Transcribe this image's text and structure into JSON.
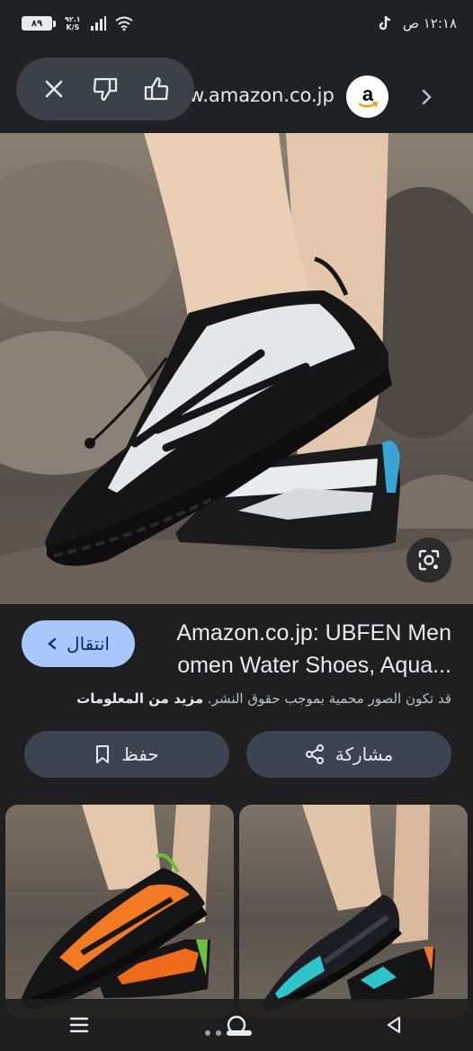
{
  "status_bar": {
    "battery": "٨٩",
    "net_speed_value": "٩٢.١",
    "net_speed_unit": "K/S",
    "time": "١٢:١٨ ص"
  },
  "toolbar": {
    "close_icon": "close-icon",
    "dislike_icon": "thumbs-down-icon",
    "like_icon": "thumbs-up-icon",
    "source_domain": "w.amazon.co.jp",
    "source_logo": "a",
    "next_icon": "chevron-right-icon"
  },
  "result": {
    "visit_label": "انتقال",
    "title_line1": "Amazon.co.jp: UBFEN Men",
    "title_line2": "omen Water Shoes, Aqua...",
    "copyright_text": "قد تكون الصور محمية بموجب حقوق النشر.",
    "more_info": "مزيد من المعلومات"
  },
  "actions": {
    "share_label": "مشاركة",
    "save_label": "حفظ"
  },
  "colors": {
    "accent": "#a8c7fa",
    "button_bg": "#3c4452",
    "background": "#1f1f1f"
  }
}
